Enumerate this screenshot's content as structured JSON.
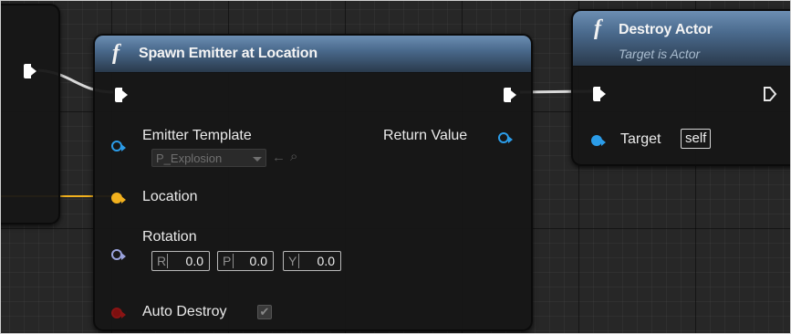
{
  "colors": {
    "exec_wire": "#d9d9d9",
    "vector_wire": "#f2b11e",
    "object_pin": "#2b9ce8",
    "vector_pin": "#f2b11e",
    "rotator_pin": "#9aa3dd",
    "bool_pin": "#8a1414",
    "header_blue": "#4a6a8d"
  },
  "spawn_node": {
    "function_icon": "f",
    "title": "Spawn Emitter at Location",
    "emitter_template_label": "Emitter Template",
    "emitter_template_value": "P_Explosion",
    "return_value_label": "Return Value",
    "location_label": "Location",
    "rotation_label": "Rotation",
    "rotation": {
      "r_axis": "R",
      "r_value": "0.0",
      "p_axis": "P",
      "p_value": "0.0",
      "y_axis": "Y",
      "y_value": "0.0"
    },
    "auto_destroy_label": "Auto Destroy",
    "auto_destroy_checked": true
  },
  "destroy_node": {
    "function_icon": "f",
    "title": "Destroy Actor",
    "subtitle": "Target is Actor",
    "target_label": "Target",
    "target_value": "self"
  },
  "icons": {
    "use_selected": "←",
    "browse": "⌕",
    "check": "✔"
  }
}
